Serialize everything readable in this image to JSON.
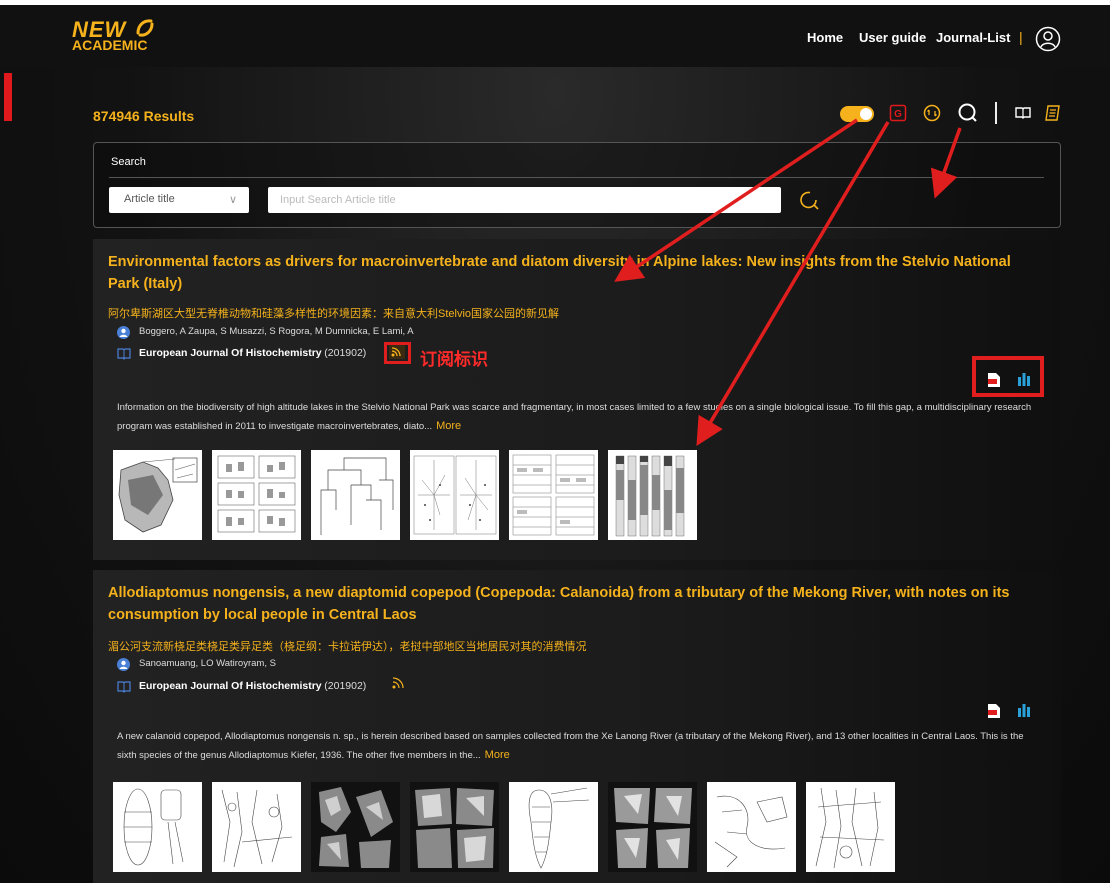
{
  "brand": {
    "line1": "NEW",
    "line2": "ACADEMIC"
  },
  "nav": {
    "items": [
      "Home",
      "User guide",
      "Journal-List"
    ],
    "separator": "|"
  },
  "results": {
    "count_label": "874946 Results"
  },
  "search": {
    "label": "Search",
    "field_selected": "Article title",
    "placeholder": "Input Search Article title"
  },
  "annotation": {
    "label": "订阅标识"
  },
  "articles": [
    {
      "title": "Environmental factors as drivers for macroinvertebrate and diatom diversity in Alpine lakes: New insights from the Stelvio National Park (Italy)",
      "title_cn": "阿尔卑斯湖区大型无脊椎动物和硅藻多样性的环境因素：来自意大利Stelvio国家公园的新见解",
      "authors": "Boggero, A  Zaupa, S  Musazzi, S  Rogora, M  Dumnicka, E  Lami, A",
      "journal": "European Journal Of Histochemistry",
      "year": "(201902)",
      "abstract": "Information on the biodiversity of high altitude lakes in the Stelvio National Park was scarce and fragmentary, in most cases limited to a few studies on a single biological issue. To fill this gap, a multidisciplinary research program was established in 2011 to investigate macroinvertebrates, diato...",
      "more": "More"
    },
    {
      "title": "Allodiaptomus nongensis, a new diaptomid copepod (Copepoda: Calanoida) from a tributary of the Mekong River, with notes on its consumption by local people in Central Laos",
      "title_cn": "湄公河支流新桡足类桡足类异足类（桡足纲：卡拉诺伊达），老挝中部地区当地居民对其的消费情况",
      "authors": "Sanoamuang, LO  Watiroyram, S",
      "journal": "European Journal Of Histochemistry",
      "year": "(201902)",
      "abstract": "A new calanoid copepod, Allodiaptomus nongensis n. sp., is herein described based on samples collected from the Xe Lanong River (a tributary of the Mekong River), and 13 other localities in Central Laos. This is the sixth species of the genus Allodiaptomus Kiefer, 1936. The other five members in the...",
      "more": "More"
    }
  ],
  "colors": {
    "accent": "#f5b21c",
    "annotation_red": "#e01e1e",
    "toolbar_red": "#e0191c"
  }
}
